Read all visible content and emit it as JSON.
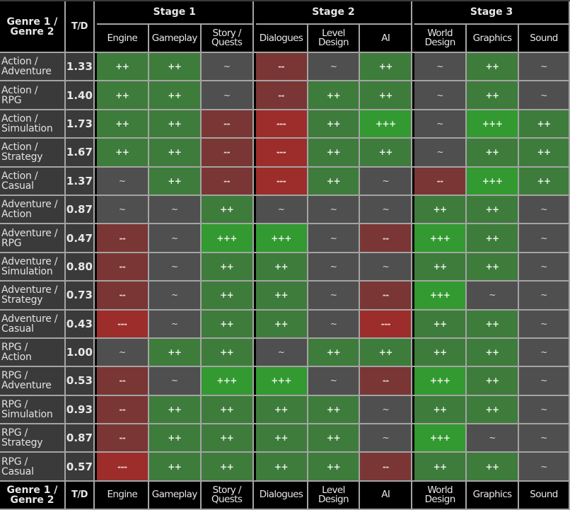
{
  "header": {
    "genre_label": "Genre 1 / Genre 2",
    "genre_line1": "Genre 1 /",
    "genre_line2": "Genre 2",
    "td_label": "T/D",
    "stages": [
      {
        "label": "Stage 1",
        "columns": [
          {
            "line1": "Engine",
            "line2": ""
          },
          {
            "line1": "Gameplay",
            "line2": ""
          },
          {
            "line1": "Story /",
            "line2": "Quests"
          }
        ]
      },
      {
        "label": "Stage 2",
        "columns": [
          {
            "line1": "Dialogues",
            "line2": ""
          },
          {
            "line1": "Level",
            "line2": "Design"
          },
          {
            "line1": "AI",
            "line2": ""
          }
        ]
      },
      {
        "label": "Stage 3",
        "columns": [
          {
            "line1": "World",
            "line2": "Design"
          },
          {
            "line1": "Graphics",
            "line2": ""
          },
          {
            "line1": "Sound",
            "line2": ""
          }
        ]
      }
    ]
  },
  "legend_colors": {
    "+++": "#329a31",
    "++": "#3e7c3b",
    "~": "#4f4f4f",
    "--": "#7a3634",
    "---": "#9c2d2b"
  },
  "rows": [
    {
      "g1": "Action /",
      "g2": "Adventure",
      "td": "1.33",
      "values": [
        "++",
        "++",
        "~",
        "--",
        "~",
        "++",
        "~",
        "++",
        "~"
      ]
    },
    {
      "g1": "Action /",
      "g2": "RPG",
      "td": "1.40",
      "values": [
        "++",
        "++",
        "~",
        "--",
        "++",
        "++",
        "~",
        "++",
        "~"
      ]
    },
    {
      "g1": "Action /",
      "g2": "Simulation",
      "td": "1.73",
      "values": [
        "++",
        "++",
        "--",
        "---",
        "++",
        "+++",
        "~",
        "+++",
        "++"
      ]
    },
    {
      "g1": "Action /",
      "g2": "Strategy",
      "td": "1.67",
      "values": [
        "++",
        "++",
        "--",
        "---",
        "++",
        "++",
        "~",
        "++",
        "++"
      ]
    },
    {
      "g1": "Action /",
      "g2": "Casual",
      "td": "1.37",
      "values": [
        "~",
        "++",
        "--",
        "---",
        "++",
        "~",
        "--",
        "+++",
        "++"
      ]
    },
    {
      "g1": "Adventure /",
      "g2": "Action",
      "td": "0.87",
      "values": [
        "~",
        "~",
        "++",
        "~",
        "~",
        "~",
        "++",
        "++",
        "~"
      ]
    },
    {
      "g1": "Adventure /",
      "g2": "RPG",
      "td": "0.47",
      "values": [
        "--",
        "~",
        "+++",
        "+++",
        "~",
        "--",
        "+++",
        "++",
        "~"
      ]
    },
    {
      "g1": "Adventure /",
      "g2": "Simulation",
      "td": "0.80",
      "values": [
        "--",
        "~",
        "++",
        "++",
        "~",
        "~",
        "++",
        "++",
        "~"
      ]
    },
    {
      "g1": "Adventure /",
      "g2": "Strategy",
      "td": "0.73",
      "values": [
        "--",
        "~",
        "++",
        "++",
        "~",
        "--",
        "+++",
        "~",
        "~"
      ]
    },
    {
      "g1": "Adventure /",
      "g2": "Casual",
      "td": "0.43",
      "values": [
        "---",
        "~",
        "++",
        "++",
        "~",
        "---",
        "++",
        "++",
        "~"
      ]
    },
    {
      "g1": "RPG /",
      "g2": "Action",
      "td": "1.00",
      "values": [
        "~",
        "++",
        "++",
        "~",
        "++",
        "++",
        "++",
        "++",
        "~"
      ]
    },
    {
      "g1": "RPG /",
      "g2": "Adventure",
      "td": "0.53",
      "values": [
        "--",
        "~",
        "+++",
        "+++",
        "~",
        "--",
        "+++",
        "++",
        "~"
      ]
    },
    {
      "g1": "RPG /",
      "g2": "Simulation",
      "td": "0.93",
      "values": [
        "--",
        "++",
        "++",
        "++",
        "++",
        "~",
        "++",
        "++",
        "~"
      ]
    },
    {
      "g1": "RPG /",
      "g2": "Strategy",
      "td": "0.87",
      "values": [
        "--",
        "++",
        "++",
        "++",
        "++",
        "~",
        "+++",
        "~",
        "~"
      ]
    },
    {
      "g1": "RPG /",
      "g2": "Casual",
      "td": "0.57",
      "values": [
        "---",
        "++",
        "++",
        "++",
        "++",
        "--",
        "++",
        "++",
        "~"
      ]
    }
  ]
}
